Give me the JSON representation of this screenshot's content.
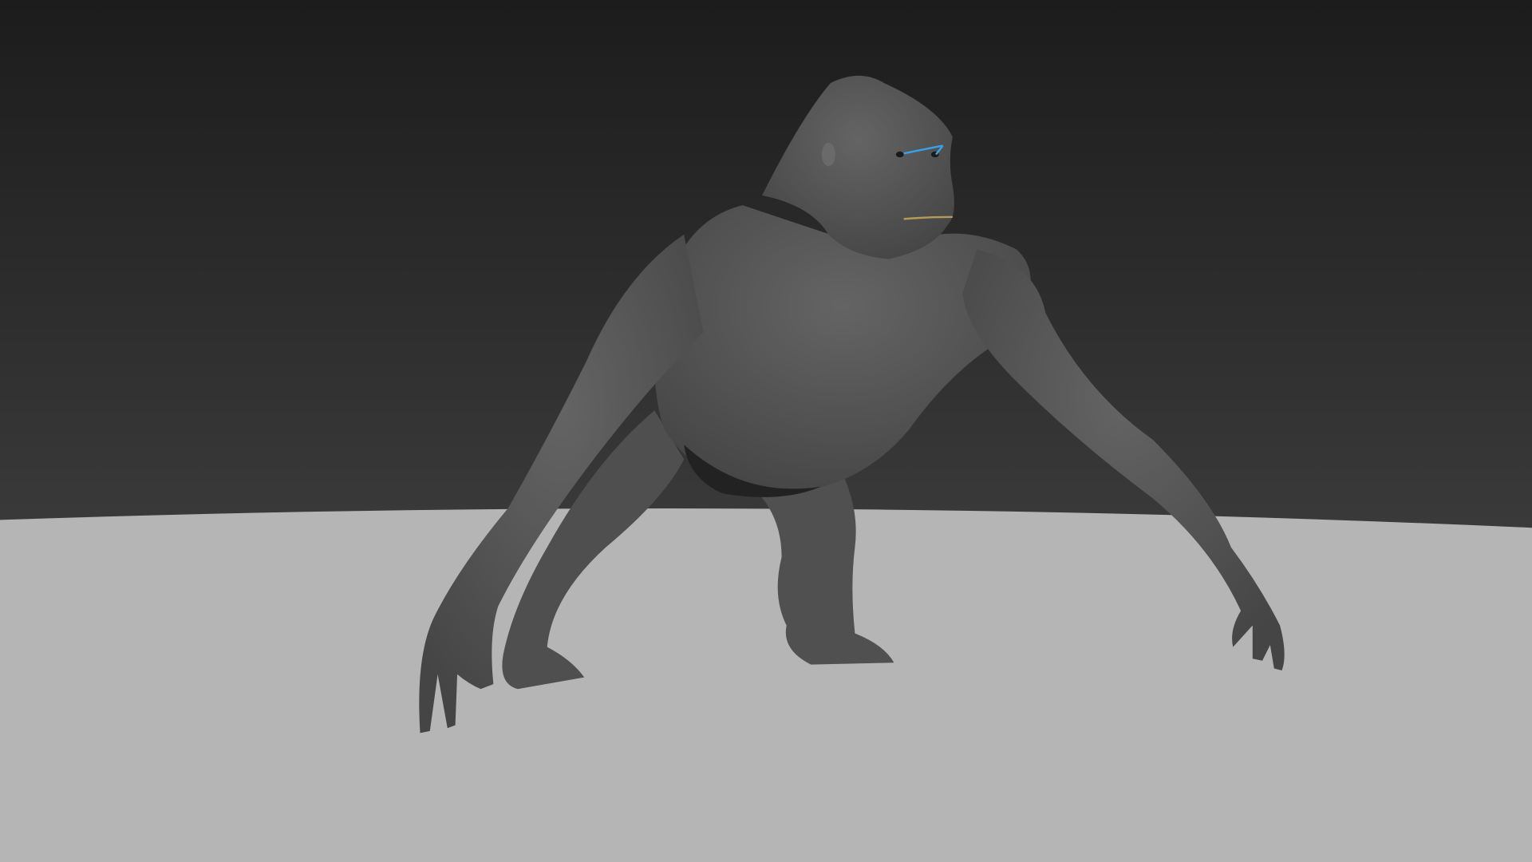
{
  "scene": {
    "subject": "gorilla-3d-model",
    "colors": {
      "sky_top": "#1d1d1d",
      "sky_bottom": "#3a3a3a",
      "floor": "#b5b5b5",
      "model": "#575757",
      "model_shadow": "#2a2a2a",
      "selection_accent": "#3aa0e6"
    }
  }
}
